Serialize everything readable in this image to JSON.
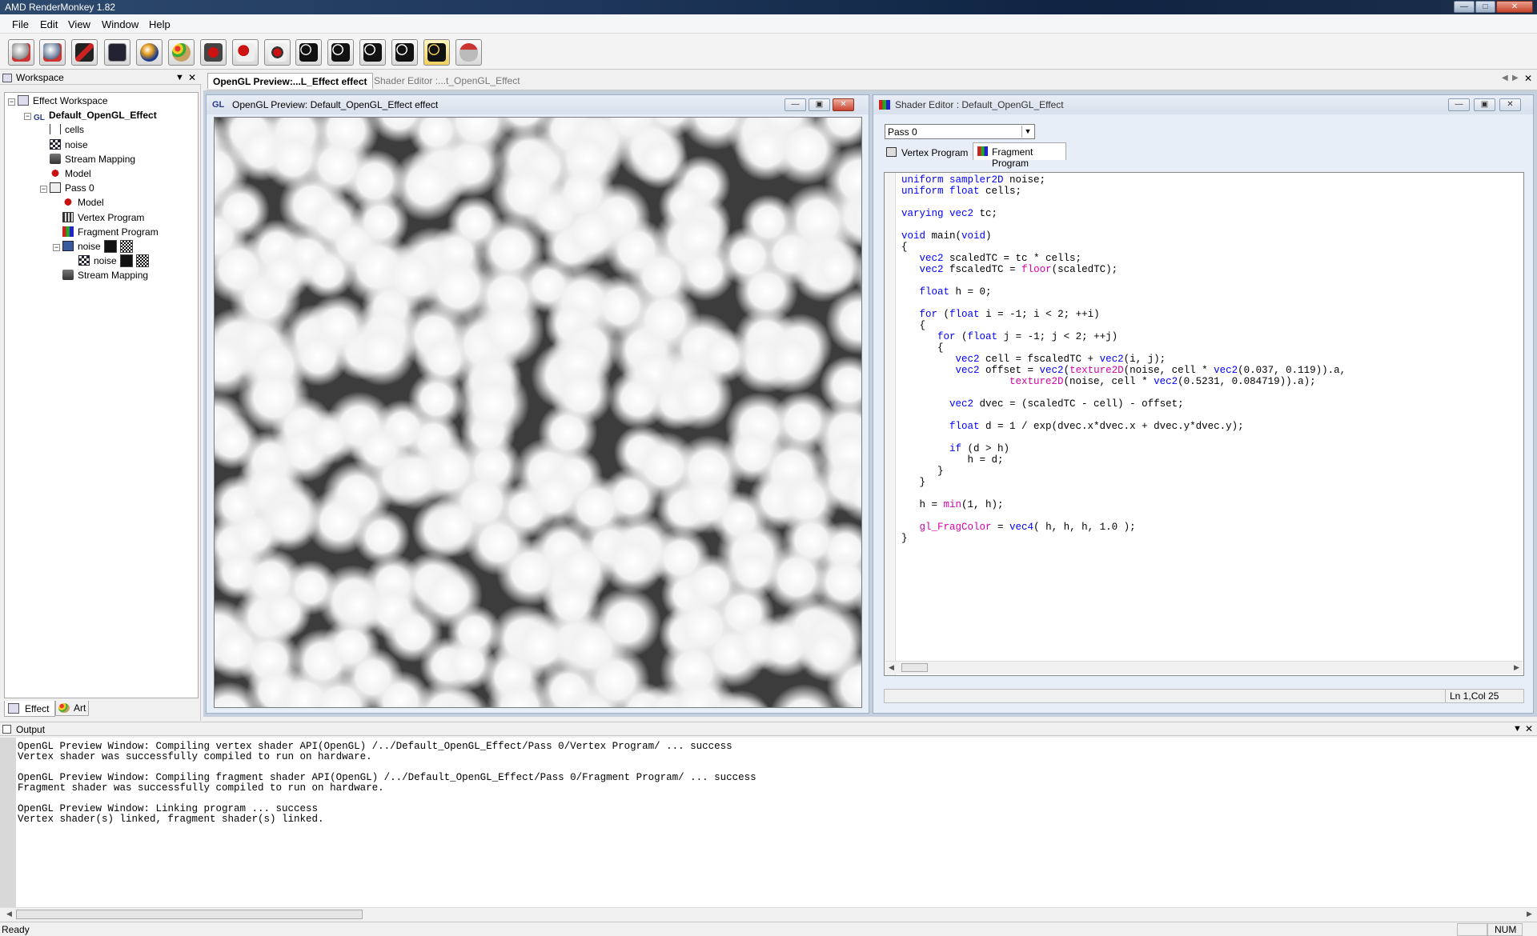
{
  "window": {
    "title": "AMD RenderMonkey 1.82"
  },
  "menu": [
    "File",
    "Edit",
    "View",
    "Window",
    "Help"
  ],
  "toolbar_icons": [
    "new-workspace-icon",
    "open-workspace-icon",
    "effect-icon",
    "render-icon",
    "sphere-icon",
    "palette-icon",
    "add-shader-icon",
    "edit-shader-icon",
    "compile-icon",
    "camera-icon",
    "camera2-icon",
    "camera3-icon",
    "camera4-icon",
    "camera5-icon",
    "mouse-icon"
  ],
  "workspace": {
    "title": "Workspace",
    "tree": [
      {
        "label": "Effect Workspace",
        "icon": "workspace-icon",
        "level": 0,
        "bold": false
      },
      {
        "label": "Default_OpenGL_Effect",
        "icon": "gl-icon",
        "level": 1,
        "bold": true
      },
      {
        "label": "cells",
        "icon": "variable-icon",
        "level": 2,
        "bold": false
      },
      {
        "label": "noise",
        "icon": "texture-icon",
        "level": 2,
        "bold": false
      },
      {
        "label": "Stream Mapping",
        "icon": "stream-icon",
        "level": 2,
        "bold": false
      },
      {
        "label": "Model",
        "icon": "model-icon",
        "level": 2,
        "bold": false
      },
      {
        "label": "Pass 0",
        "icon": "pass-icon",
        "level": 2,
        "bold": false
      },
      {
        "label": "Model",
        "icon": "model-icon",
        "level": 3,
        "bold": false
      },
      {
        "label": "Vertex Program",
        "icon": "vertex-icon",
        "level": 3,
        "bold": false
      },
      {
        "label": "Fragment Program",
        "icon": "fragment-icon",
        "level": 3,
        "bold": false
      },
      {
        "label": "noise",
        "icon": "texobj-icon",
        "level": 3,
        "bold": false
      },
      {
        "label": "noise",
        "icon": "texture-icon",
        "level": 4,
        "bold": false
      },
      {
        "label": "Stream Mapping",
        "icon": "stream-icon",
        "level": 3,
        "bold": false
      }
    ],
    "tabs": [
      "Effect",
      "Art"
    ]
  },
  "doc_tabs": [
    "OpenGL Preview:...L_Effect effect",
    "Shader Editor :...t_OpenGL_Effect"
  ],
  "preview": {
    "title": "OpenGL Preview: Default_OpenGL_Effect effect",
    "icon_text": "GL"
  },
  "editor": {
    "title": "Shader Editor : Default_OpenGL_Effect",
    "pass_select": "Pass 0",
    "tabs": [
      "Vertex Program",
      "Fragment Program"
    ],
    "status": "Ln 1,Col 25",
    "code": [
      "<span class='kw'>uniform sampler2D</span> noise;",
      "<span class='kw'>uniform float</span> cells;",
      "",
      "<span class='kw'>varying vec2</span> tc;",
      "",
      "<span class='kw'>void</span> main(<span class='kw'>void</span>)",
      "{",
      "   <span class='kw'>vec2</span> scaledTC = tc * cells;",
      "   <span class='kw'>vec2</span> fscaledTC = <span class='fn'>floor</span>(scaledTC);",
      "",
      "   <span class='kw'>float</span> h = 0;",
      "",
      "   <span class='kw'>for</span> (<span class='kw'>float</span> i = -1; i &lt; 2; ++i)",
      "   {",
      "      <span class='kw'>for</span> (<span class='kw'>float</span> j = -1; j &lt; 2; ++j)",
      "      {",
      "         <span class='kw'>vec2</span> cell = fscaledTC + <span class='kw'>vec2</span>(i, j);",
      "         <span class='kw'>vec2</span> offset = <span class='kw'>vec2</span>(<span class='fn'>texture2D</span>(noise, cell * <span class='kw'>vec2</span>(0.037, 0.119)).a,",
      "                  <span class='fn'>texture2D</span>(noise, cell * <span class='kw'>vec2</span>(0.5231, 0.084719)).a);",
      "",
      "        <span class='kw'>vec2</span> dvec = (scaledTC - cell) - offset;",
      "",
      "        <span class='kw'>float</span> d = 1 / exp(dvec.x*dvec.x + dvec.y*dvec.y);",
      "",
      "        <span class='kw'>if</span> (d &gt; h)",
      "           h = d;",
      "      }",
      "   }",
      "",
      "   h = <span class='fn'>min</span>(1, h);",
      "",
      "   <span class='fn'>gl_FragColor</span> = <span class='kw'>vec4</span>( h, h, h, 1.0 );",
      "}"
    ]
  },
  "output": {
    "title": "Output",
    "lines": [
      "OpenGL Preview Window: Compiling vertex shader API(OpenGL) /../Default_OpenGL_Effect/Pass 0/Vertex Program/ ... success",
      "Vertex shader was successfully compiled to run on hardware.",
      "",
      "OpenGL Preview Window: Compiling fragment shader API(OpenGL) /../Default_OpenGL_Effect/Pass 0/Fragment Program/ ... success",
      "Fragment shader was successfully compiled to run on hardware.",
      "",
      "OpenGL Preview Window: Linking program ... success",
      "Vertex shader(s) linked, fragment shader(s) linked."
    ]
  },
  "statusbar": {
    "text": "Ready",
    "num": "NUM"
  },
  "colors": {
    "keyword": "#0000ff",
    "builtin": "#d400a8",
    "title_bar": "#1d3558"
  }
}
